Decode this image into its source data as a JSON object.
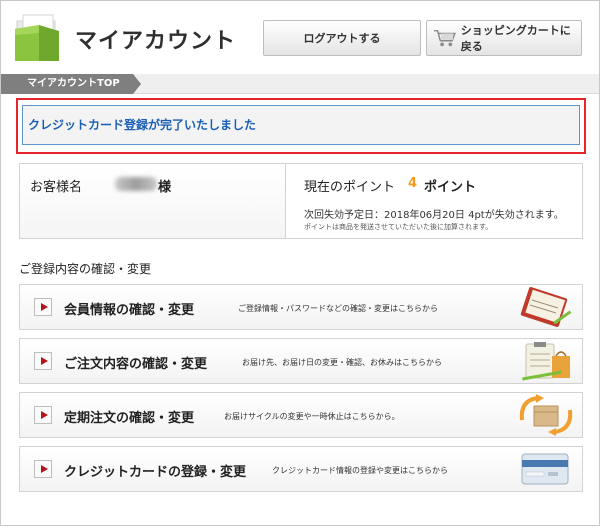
{
  "header": {
    "logo_text": "マイアカウント",
    "logout_label": "ログアウトする",
    "cart_label": "ショッピングカートに戻る"
  },
  "breadcrumb": {
    "current": "マイアカウントTOP"
  },
  "alert": {
    "message": "クレジットカード登録が完了いたしました"
  },
  "customer": {
    "label": "お客様名",
    "name_suffix": "様",
    "points_label": "現在のポイント",
    "points_value": "4",
    "points_unit": "ポイント",
    "expire_text": "次回失効予定日：2018年06月20日 4ptが失効されます。",
    "points_note": "ポイントは商品を発送させていただいた後に加算されます。"
  },
  "section": {
    "title": "ご登録内容の確認・変更"
  },
  "menu": [
    {
      "title": "会員情報の確認・変更",
      "desc": "ご登録情報・パスワードなどの確認・変更はこちらから",
      "icon": "notebook-icon"
    },
    {
      "title": "ご注文内容の確認・変更",
      "desc": "お届け先、お届け日の変更・確認、お休みはこちらから",
      "icon": "clipboard-bag-icon"
    },
    {
      "title": "定期注文の確認・変更",
      "desc": "お届けサイクルの変更や一時休止はこちらから。",
      "icon": "boxes-cycle-icon"
    },
    {
      "title": "クレジットカードの登録・変更",
      "desc": "クレジットカード情報の登録や変更はこちらから",
      "icon": "credit-card-icon"
    }
  ],
  "colors": {
    "accent_blue": "#1a5fb4",
    "alert_border": "#e5252b",
    "points_orange": "#f09a1a",
    "arrow_red": "#b0151b"
  }
}
